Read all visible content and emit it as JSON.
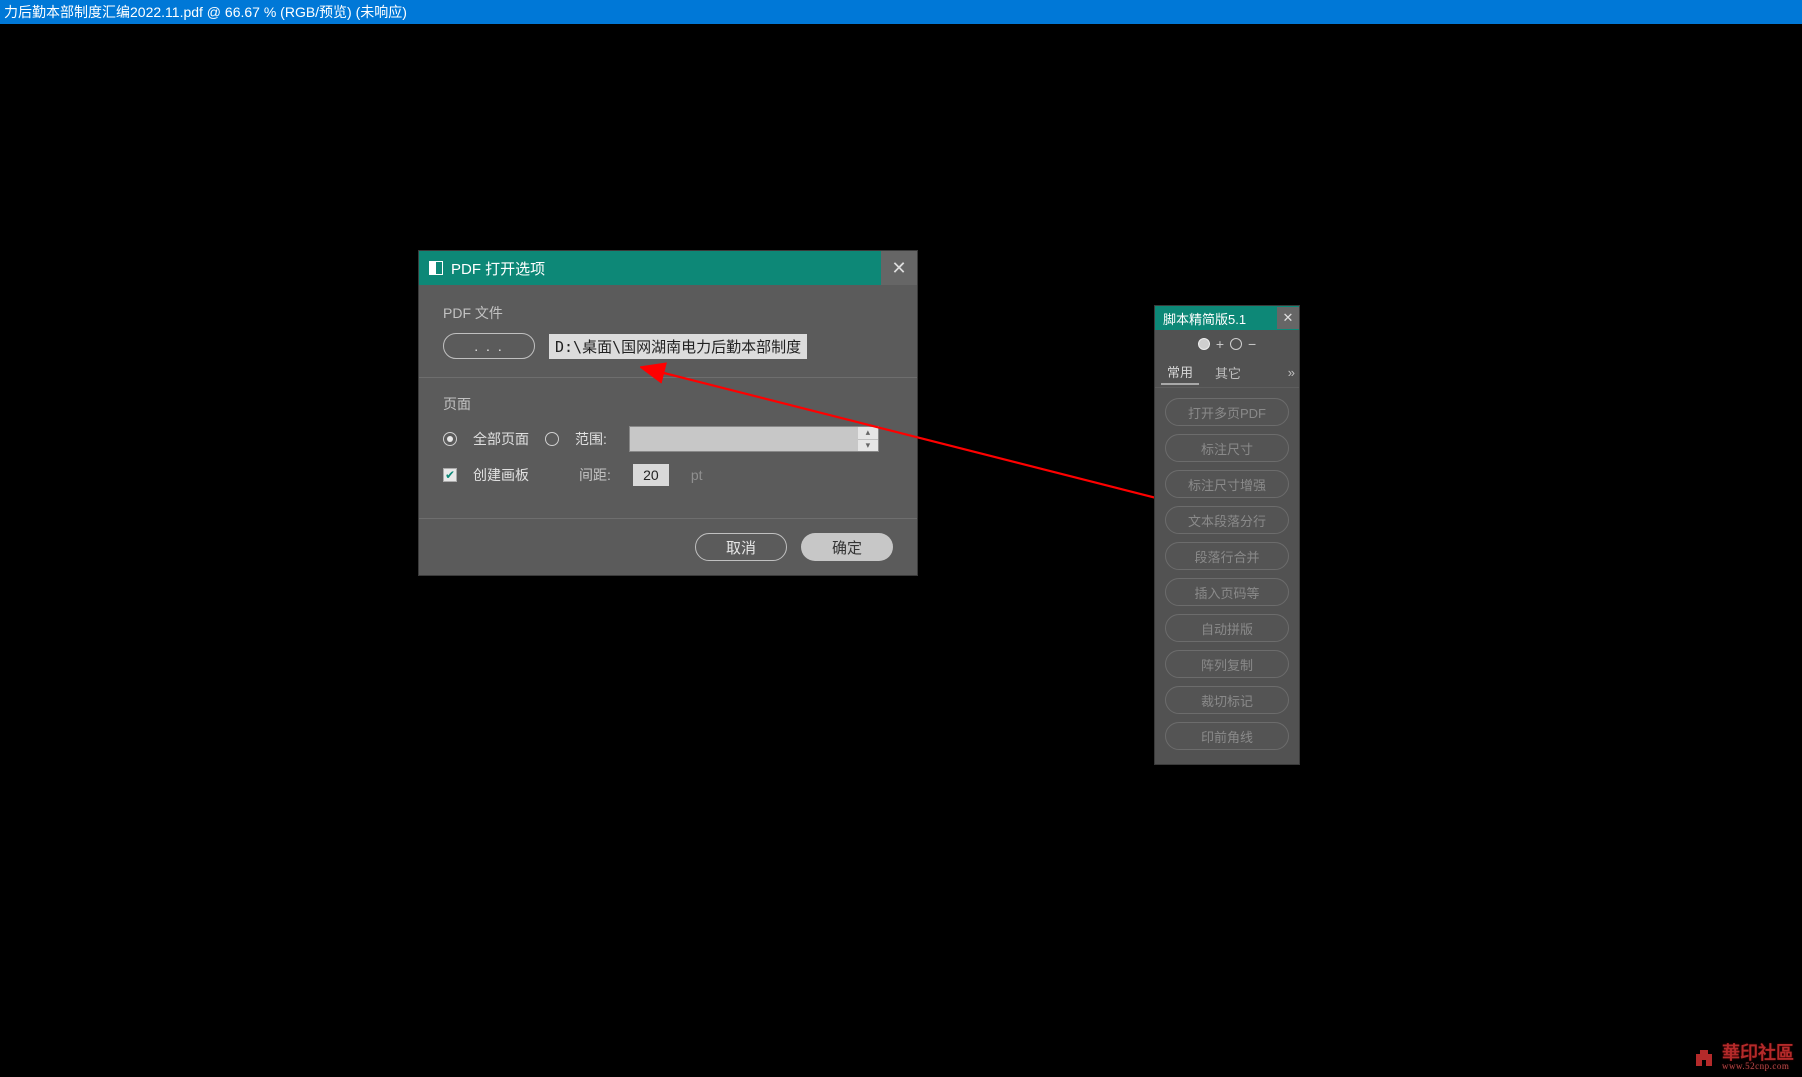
{
  "titlebar": {
    "text": "力后勤本部制度汇编2022.11.pdf @ 66.67 % (RGB/预览)  (未响应)"
  },
  "dialog": {
    "title": "PDF 打开选项",
    "file_section_label": "PDF 文件",
    "browse_label": ". . .",
    "file_path": "D:\\桌面\\国网湖南电力后勤本部制度",
    "page_section_label": "页面",
    "radio_all_label": "全部页面",
    "radio_range_label": "范围:",
    "checkbox_artboard_label": "创建画板",
    "gap_label": "间距:",
    "gap_value": "20",
    "gap_unit": "pt",
    "cancel_label": "取消",
    "ok_label": "确定"
  },
  "scriptpanel": {
    "title": "脚本精简版5.1",
    "toolbar_plus": "+",
    "toolbar_minus": "−",
    "tab_common": "常用",
    "tab_other": "其它",
    "tab_more": "»",
    "buttons": [
      "打开多页PDF",
      "标注尺寸",
      "标注尺寸增强",
      "文本段落分行",
      "段落行合并",
      "插入页码等",
      "自动拼版",
      "阵列复制",
      "裁切标记",
      "印前角线"
    ]
  },
  "watermark": {
    "text": "華印社區",
    "url": "www.52cnp.com"
  }
}
